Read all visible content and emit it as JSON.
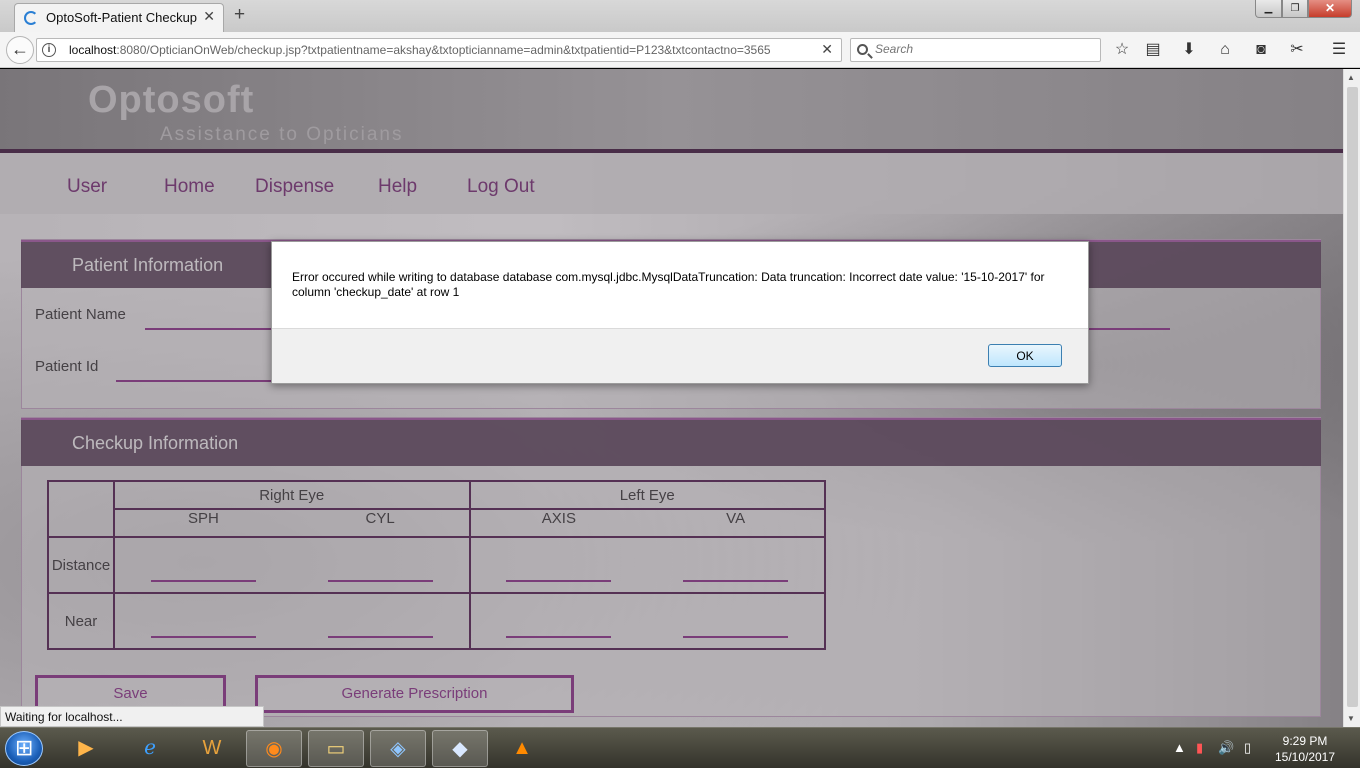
{
  "browser": {
    "tab_title": "OptoSoft-Patient Checkup",
    "url_host": "localhost",
    "url_rest": ":8080/OpticianOnWeb/checkup.jsp?txtpatientname=akshay&txtopticianname=admin&txtpatientid=P123&txtcontactno=3565",
    "search_placeholder": "Search",
    "status": "Waiting for localhost..."
  },
  "page": {
    "brand": "Optosoft",
    "tagline": "Assistance to Opticians",
    "menu": [
      "User",
      "Home",
      "Dispense",
      "Help",
      "Log Out"
    ],
    "patient_section": "Patient Information",
    "patient_name_label": "Patient Name",
    "patient_id_label": "Patient Id",
    "checkup_section": "Checkup Information",
    "table": {
      "right_eye": "Right Eye",
      "left_eye": "Left Eye",
      "cols": [
        "SPH",
        "CYL",
        "AXIS",
        "VA"
      ],
      "rows": [
        "Distance",
        "Near"
      ]
    },
    "save_label": "Save",
    "generate_label": "Generate Prescription"
  },
  "dialog": {
    "message": "Error occured while writing to database database com.mysql.jdbc.MysqlDataTruncation: Data truncation: Incorrect date value: '15-10-2017' for column 'checkup_date' at row 1",
    "ok_label": "OK"
  },
  "taskbar": {
    "time": "9:29 PM",
    "date": "15/10/2017"
  }
}
